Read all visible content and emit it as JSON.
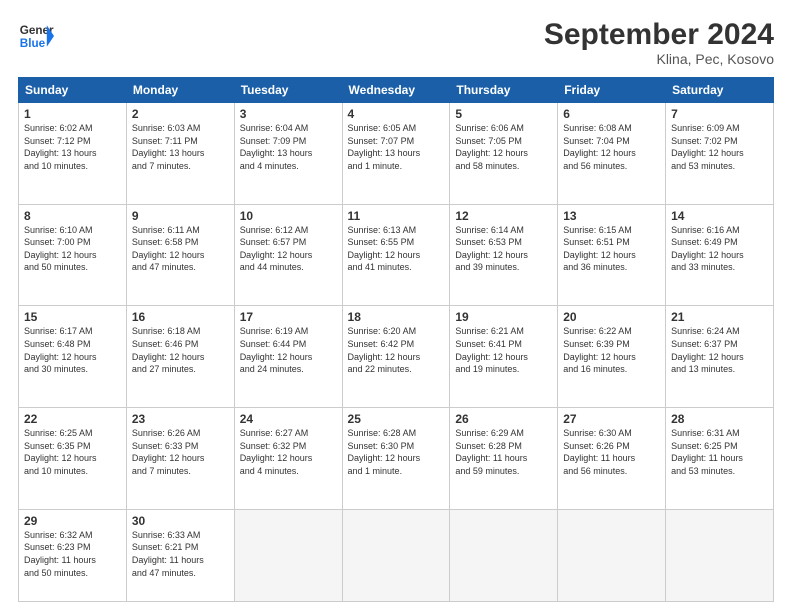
{
  "logo": {
    "line1": "General",
    "line2": "Blue"
  },
  "title": "September 2024",
  "subtitle": "Klina, Pec, Kosovo",
  "days_of_week": [
    "Sunday",
    "Monday",
    "Tuesday",
    "Wednesday",
    "Thursday",
    "Friday",
    "Saturday"
  ],
  "weeks": [
    [
      {
        "day": "1",
        "info": "Sunrise: 6:02 AM\nSunset: 7:12 PM\nDaylight: 13 hours\nand 10 minutes."
      },
      {
        "day": "2",
        "info": "Sunrise: 6:03 AM\nSunset: 7:11 PM\nDaylight: 13 hours\nand 7 minutes."
      },
      {
        "day": "3",
        "info": "Sunrise: 6:04 AM\nSunset: 7:09 PM\nDaylight: 13 hours\nand 4 minutes."
      },
      {
        "day": "4",
        "info": "Sunrise: 6:05 AM\nSunset: 7:07 PM\nDaylight: 13 hours\nand 1 minute."
      },
      {
        "day": "5",
        "info": "Sunrise: 6:06 AM\nSunset: 7:05 PM\nDaylight: 12 hours\nand 58 minutes."
      },
      {
        "day": "6",
        "info": "Sunrise: 6:08 AM\nSunset: 7:04 PM\nDaylight: 12 hours\nand 56 minutes."
      },
      {
        "day": "7",
        "info": "Sunrise: 6:09 AM\nSunset: 7:02 PM\nDaylight: 12 hours\nand 53 minutes."
      }
    ],
    [
      {
        "day": "8",
        "info": "Sunrise: 6:10 AM\nSunset: 7:00 PM\nDaylight: 12 hours\nand 50 minutes."
      },
      {
        "day": "9",
        "info": "Sunrise: 6:11 AM\nSunset: 6:58 PM\nDaylight: 12 hours\nand 47 minutes."
      },
      {
        "day": "10",
        "info": "Sunrise: 6:12 AM\nSunset: 6:57 PM\nDaylight: 12 hours\nand 44 minutes."
      },
      {
        "day": "11",
        "info": "Sunrise: 6:13 AM\nSunset: 6:55 PM\nDaylight: 12 hours\nand 41 minutes."
      },
      {
        "day": "12",
        "info": "Sunrise: 6:14 AM\nSunset: 6:53 PM\nDaylight: 12 hours\nand 39 minutes."
      },
      {
        "day": "13",
        "info": "Sunrise: 6:15 AM\nSunset: 6:51 PM\nDaylight: 12 hours\nand 36 minutes."
      },
      {
        "day": "14",
        "info": "Sunrise: 6:16 AM\nSunset: 6:49 PM\nDaylight: 12 hours\nand 33 minutes."
      }
    ],
    [
      {
        "day": "15",
        "info": "Sunrise: 6:17 AM\nSunset: 6:48 PM\nDaylight: 12 hours\nand 30 minutes."
      },
      {
        "day": "16",
        "info": "Sunrise: 6:18 AM\nSunset: 6:46 PM\nDaylight: 12 hours\nand 27 minutes."
      },
      {
        "day": "17",
        "info": "Sunrise: 6:19 AM\nSunset: 6:44 PM\nDaylight: 12 hours\nand 24 minutes."
      },
      {
        "day": "18",
        "info": "Sunrise: 6:20 AM\nSunset: 6:42 PM\nDaylight: 12 hours\nand 22 minutes."
      },
      {
        "day": "19",
        "info": "Sunrise: 6:21 AM\nSunset: 6:41 PM\nDaylight: 12 hours\nand 19 minutes."
      },
      {
        "day": "20",
        "info": "Sunrise: 6:22 AM\nSunset: 6:39 PM\nDaylight: 12 hours\nand 16 minutes."
      },
      {
        "day": "21",
        "info": "Sunrise: 6:24 AM\nSunset: 6:37 PM\nDaylight: 12 hours\nand 13 minutes."
      }
    ],
    [
      {
        "day": "22",
        "info": "Sunrise: 6:25 AM\nSunset: 6:35 PM\nDaylight: 12 hours\nand 10 minutes."
      },
      {
        "day": "23",
        "info": "Sunrise: 6:26 AM\nSunset: 6:33 PM\nDaylight: 12 hours\nand 7 minutes."
      },
      {
        "day": "24",
        "info": "Sunrise: 6:27 AM\nSunset: 6:32 PM\nDaylight: 12 hours\nand 4 minutes."
      },
      {
        "day": "25",
        "info": "Sunrise: 6:28 AM\nSunset: 6:30 PM\nDaylight: 12 hours\nand 1 minute."
      },
      {
        "day": "26",
        "info": "Sunrise: 6:29 AM\nSunset: 6:28 PM\nDaylight: 11 hours\nand 59 minutes."
      },
      {
        "day": "27",
        "info": "Sunrise: 6:30 AM\nSunset: 6:26 PM\nDaylight: 11 hours\nand 56 minutes."
      },
      {
        "day": "28",
        "info": "Sunrise: 6:31 AM\nSunset: 6:25 PM\nDaylight: 11 hours\nand 53 minutes."
      }
    ],
    [
      {
        "day": "29",
        "info": "Sunrise: 6:32 AM\nSunset: 6:23 PM\nDaylight: 11 hours\nand 50 minutes."
      },
      {
        "day": "30",
        "info": "Sunrise: 6:33 AM\nSunset: 6:21 PM\nDaylight: 11 hours\nand 47 minutes."
      },
      {
        "day": "",
        "info": ""
      },
      {
        "day": "",
        "info": ""
      },
      {
        "day": "",
        "info": ""
      },
      {
        "day": "",
        "info": ""
      },
      {
        "day": "",
        "info": ""
      }
    ]
  ]
}
